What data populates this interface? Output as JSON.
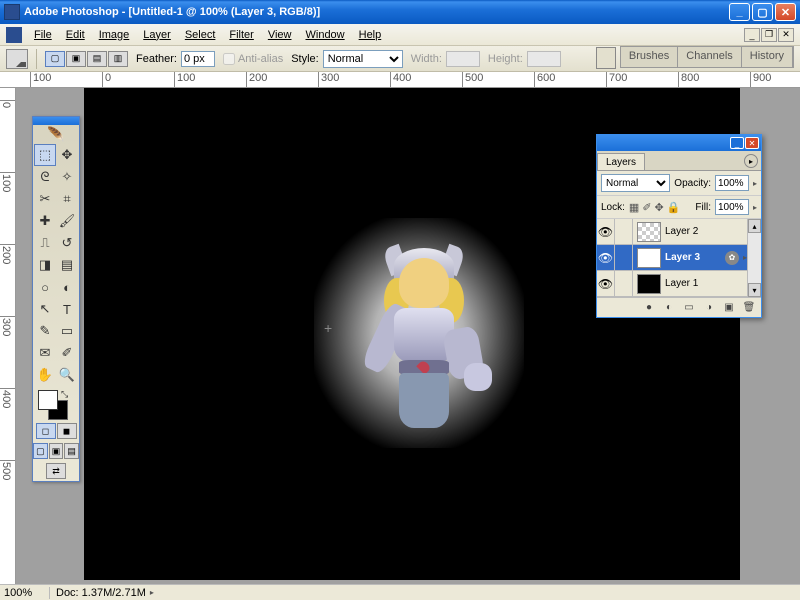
{
  "title": "Adobe Photoshop - [Untitled-1 @ 100% (Layer 3, RGB/8)]",
  "menu": [
    "File",
    "Edit",
    "Image",
    "Layer",
    "Select",
    "Filter",
    "View",
    "Window",
    "Help"
  ],
  "options": {
    "feather_label": "Feather:",
    "feather_value": "0 px",
    "antialias": "Anti-alias",
    "style_label": "Style:",
    "style_value": "Normal",
    "width_label": "Width:",
    "width_value": "",
    "height_label": "Height:",
    "height_value": ""
  },
  "palette_tabs": [
    "Brushes",
    "Channels",
    "History"
  ],
  "ruler_h": [
    "100",
    "0",
    "100",
    "200",
    "300",
    "400",
    "500",
    "600",
    "700",
    "800",
    "900"
  ],
  "ruler_v": [
    "0",
    "100",
    "200",
    "300",
    "400",
    "500"
  ],
  "layers": {
    "tab": "Layers",
    "blend_mode": "Normal",
    "opacity_label": "Opacity:",
    "opacity_value": "100%",
    "lock_label": "Lock:",
    "fill_label": "Fill:",
    "fill_value": "100%",
    "items": [
      {
        "name": "Layer 2",
        "thumb": "checker",
        "selected": false
      },
      {
        "name": "Layer 3",
        "thumb": "white",
        "selected": true
      },
      {
        "name": "Layer 1",
        "thumb": "black",
        "selected": false
      }
    ]
  },
  "status": {
    "zoom": "100%",
    "doc": "Doc: 1.37M/2.71M"
  },
  "tool_glyphs": {
    "marquee": "⬚",
    "move": "✥",
    "lasso": "ᘓ",
    "wand": "✧",
    "crop": "✂",
    "slice": "⌗",
    "heal": "✚",
    "brush": "🖌",
    "stamp": "⎍",
    "history": "↺",
    "eraser": "◨",
    "grad": "▤",
    "blur": "○",
    "dodge": "◐",
    "path": "↖",
    "type": "T",
    "pen": "✎",
    "shape": "▭",
    "notes": "✉",
    "eyedrop": "✐",
    "hand": "✋",
    "zoom": "🔍"
  }
}
